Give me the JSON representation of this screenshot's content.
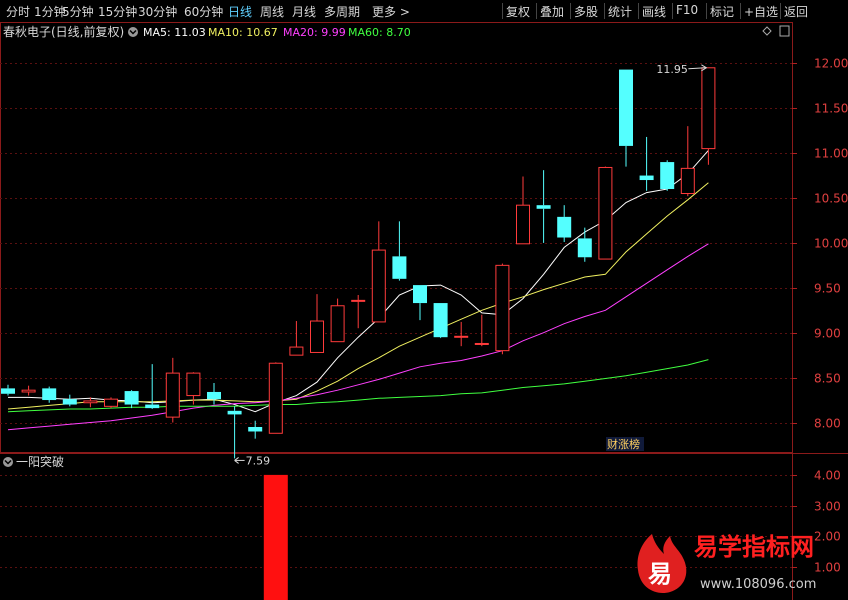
{
  "toolbar": {
    "left": [
      "分时",
      "1分钟",
      "5分钟",
      "15分钟",
      "30分钟",
      "60分钟",
      "日线",
      "周线",
      "月线",
      "多周期",
      "更多 >"
    ],
    "active": "日线",
    "right": [
      "复权",
      "叠加",
      "多股",
      "统计",
      "画线",
      "F10",
      "标记",
      "+自选",
      "返回"
    ]
  },
  "header": {
    "stock": "春秋电子(日线,前复权)",
    "ma_items": [
      {
        "label": "MA5: 11.03",
        "color": "#ffffff"
      },
      {
        "label": "MA10: 10.67",
        "color": "#f0f060"
      },
      {
        "label": "MA20: 9.99",
        "color": "#ff40ff"
      },
      {
        "label": "MA60: 8.70",
        "color": "#40ff40"
      }
    ]
  },
  "indicator": {
    "title": "一阳突破"
  },
  "annotations": {
    "high": "11.95",
    "low": "7.59",
    "badge": "财涨榜"
  },
  "watermark": {
    "name": "易学指标网",
    "url": "www.108096.com",
    "glyph": "易"
  },
  "chart_data": {
    "type": "candlestick",
    "price_axis": {
      "range": [
        7.6,
        12.15
      ],
      "ticks": [
        "12.00",
        "11.50",
        "11.00",
        "10.50",
        "10.00",
        "9.50",
        "9.00",
        "8.50",
        "8.00"
      ]
    },
    "indicator_axis": {
      "range": [
        0,
        4.5
      ],
      "ticks": [
        "4.00",
        "3.00",
        "2.00",
        "1.00"
      ]
    },
    "candles": [
      {
        "o": 8.38,
        "h": 8.42,
        "l": 8.3,
        "c": 8.32
      },
      {
        "o": 8.34,
        "h": 8.41,
        "l": 8.3,
        "c": 8.36
      },
      {
        "o": 8.38,
        "h": 8.4,
        "l": 8.22,
        "c": 8.25
      },
      {
        "o": 8.26,
        "h": 8.31,
        "l": 8.18,
        "c": 8.2
      },
      {
        "o": 8.22,
        "h": 8.28,
        "l": 8.17,
        "c": 8.24
      },
      {
        "o": 8.18,
        "h": 8.28,
        "l": 8.16,
        "c": 8.26
      },
      {
        "o": 8.35,
        "h": 8.36,
        "l": 8.16,
        "c": 8.2
      },
      {
        "o": 8.2,
        "h": 8.65,
        "l": 8.15,
        "c": 8.16
      },
      {
        "o": 8.06,
        "h": 8.72,
        "l": 8.0,
        "c": 8.55
      },
      {
        "o": 8.3,
        "h": 8.56,
        "l": 8.2,
        "c": 8.55
      },
      {
        "o": 8.34,
        "h": 8.44,
        "l": 8.2,
        "c": 8.26
      },
      {
        "o": 8.13,
        "h": 8.18,
        "l": 7.6,
        "c": 8.09
      },
      {
        "o": 7.95,
        "h": 8.02,
        "l": 7.82,
        "c": 7.9
      },
      {
        "o": 7.88,
        "h": 8.67,
        "l": 7.88,
        "c": 8.66
      },
      {
        "o": 8.75,
        "h": 9.13,
        "l": 8.75,
        "c": 8.84
      },
      {
        "o": 8.78,
        "h": 9.43,
        "l": 8.78,
        "c": 9.13
      },
      {
        "o": 8.9,
        "h": 9.38,
        "l": 8.9,
        "c": 9.3
      },
      {
        "o": 9.36,
        "h": 9.42,
        "l": 9.05,
        "c": 9.36
      },
      {
        "o": 9.12,
        "h": 10.24,
        "l": 9.12,
        "c": 9.92
      },
      {
        "o": 9.85,
        "h": 10.24,
        "l": 9.58,
        "c": 9.6
      },
      {
        "o": 9.53,
        "h": 9.53,
        "l": 9.14,
        "c": 9.33
      },
      {
        "o": 9.33,
        "h": 9.33,
        "l": 8.94,
        "c": 8.95
      },
      {
        "o": 8.96,
        "h": 9.12,
        "l": 8.85,
        "c": 8.96
      },
      {
        "o": 8.87,
        "h": 9.2,
        "l": 8.85,
        "c": 8.88
      },
      {
        "o": 8.8,
        "h": 9.77,
        "l": 8.76,
        "c": 9.75
      },
      {
        "o": 9.99,
        "h": 10.74,
        "l": 9.99,
        "c": 10.42
      },
      {
        "o": 10.42,
        "h": 10.81,
        "l": 10.0,
        "c": 10.38
      },
      {
        "o": 10.29,
        "h": 10.42,
        "l": 10.01,
        "c": 10.06
      },
      {
        "o": 10.05,
        "h": 10.17,
        "l": 9.79,
        "c": 9.84
      },
      {
        "o": 9.82,
        "h": 10.85,
        "l": 9.82,
        "c": 10.84
      },
      {
        "o": 11.93,
        "h": 11.93,
        "l": 10.85,
        "c": 11.08
      },
      {
        "o": 10.75,
        "h": 11.18,
        "l": 10.58,
        "c": 10.7
      },
      {
        "o": 10.9,
        "h": 10.92,
        "l": 10.58,
        "c": 10.6
      },
      {
        "o": 10.55,
        "h": 11.3,
        "l": 10.52,
        "c": 10.83
      },
      {
        "o": 11.05,
        "h": 11.95,
        "l": 10.87,
        "c": 11.95
      }
    ],
    "series": [
      {
        "name": "MA5",
        "color": "#ffffff",
        "values": [
          8.28,
          8.28,
          8.27,
          8.26,
          8.27,
          8.25,
          8.24,
          8.22,
          8.23,
          8.25,
          8.26,
          8.2,
          8.12,
          8.22,
          8.3,
          8.45,
          8.72,
          8.95,
          9.16,
          9.42,
          9.52,
          9.53,
          9.42,
          9.22,
          9.2,
          9.38,
          9.65,
          9.95,
          10.12,
          10.25,
          10.45,
          10.56,
          10.6,
          10.77,
          11.03
        ]
      },
      {
        "name": "MA10",
        "color": "#f0f060",
        "values": [
          8.15,
          8.17,
          8.19,
          8.21,
          8.23,
          8.23,
          8.23,
          8.23,
          8.24,
          8.25,
          8.25,
          8.24,
          8.23,
          8.24,
          8.26,
          8.35,
          8.46,
          8.6,
          8.72,
          8.85,
          8.95,
          9.05,
          9.15,
          9.25,
          9.33,
          9.4,
          9.48,
          9.55,
          9.62,
          9.65,
          9.9,
          10.1,
          10.3,
          10.48,
          10.67
        ]
      },
      {
        "name": "MA20",
        "color": "#ff40ff",
        "values": [
          7.92,
          7.94,
          7.96,
          7.98,
          8.0,
          8.02,
          8.05,
          8.08,
          8.12,
          8.16,
          8.19,
          8.21,
          8.22,
          8.24,
          8.27,
          8.31,
          8.36,
          8.42,
          8.48,
          8.55,
          8.62,
          8.66,
          8.69,
          8.74,
          8.8,
          8.91,
          9.0,
          9.1,
          9.18,
          9.25,
          9.4,
          9.55,
          9.7,
          9.85,
          9.99
        ]
      },
      {
        "name": "MA60",
        "color": "#40ff40",
        "values": [
          8.12,
          8.13,
          8.14,
          8.15,
          8.15,
          8.16,
          8.17,
          8.17,
          8.18,
          8.18,
          8.18,
          8.18,
          8.19,
          8.2,
          8.2,
          8.22,
          8.23,
          8.25,
          8.27,
          8.28,
          8.29,
          8.3,
          8.32,
          8.33,
          8.36,
          8.39,
          8.41,
          8.43,
          8.46,
          8.49,
          8.52,
          8.56,
          8.6,
          8.64,
          8.7
        ]
      }
    ],
    "indicator_bars": [
      {
        "index": 13,
        "value": 4.0
      }
    ]
  }
}
